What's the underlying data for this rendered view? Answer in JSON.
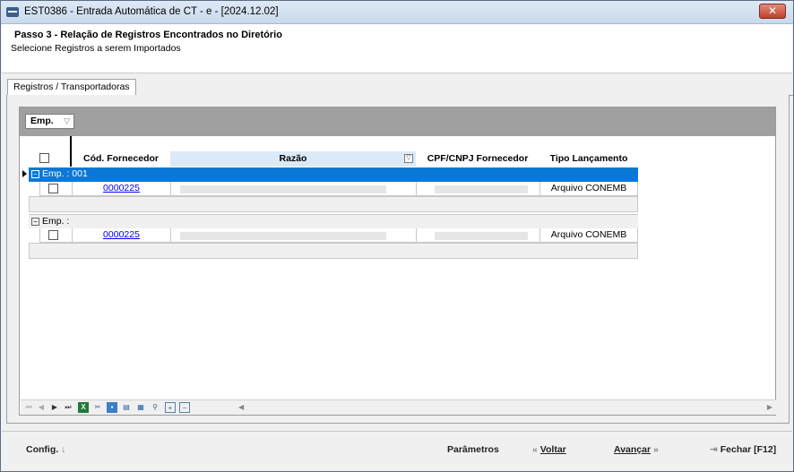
{
  "window": {
    "title": "EST0386 - Entrada Automática de CT - e - [2024.12.02]",
    "close_label": "✕"
  },
  "header": {
    "title": "Passo 3 - Relação de Registros Encontrados no Diretório",
    "subtitle": "Selecione Registros a serem Importados"
  },
  "tabs": [
    {
      "label": "Registros / Transportadoras"
    }
  ],
  "grid": {
    "group_by": "Emp.",
    "columns": [
      "Cód. Fornecedor",
      "Razão",
      "CPF/CNPJ Fornecedor",
      "Tipo Lançamento"
    ],
    "groups": [
      {
        "label": "Emp. : 001",
        "rows": [
          {
            "cod_fornecedor": "0000225",
            "tipo_lancamento": "Arquivo CONEMB"
          }
        ]
      },
      {
        "label": "Emp. :",
        "rows": [
          {
            "cod_fornecedor": "0000225",
            "tipo_lancamento": "Arquivo CONEMB"
          }
        ]
      }
    ]
  },
  "footer": {
    "config_label": "Config.",
    "parametros_label": "Parâmetros",
    "voltar_label": "Voltar",
    "avancar_label": "Avançar",
    "fechar_label": "Fechar [F12]"
  },
  "colors": {
    "selection": "#0a78d7",
    "group_bar": "#a0a0a0",
    "title_bar": "#c9d9ec"
  }
}
